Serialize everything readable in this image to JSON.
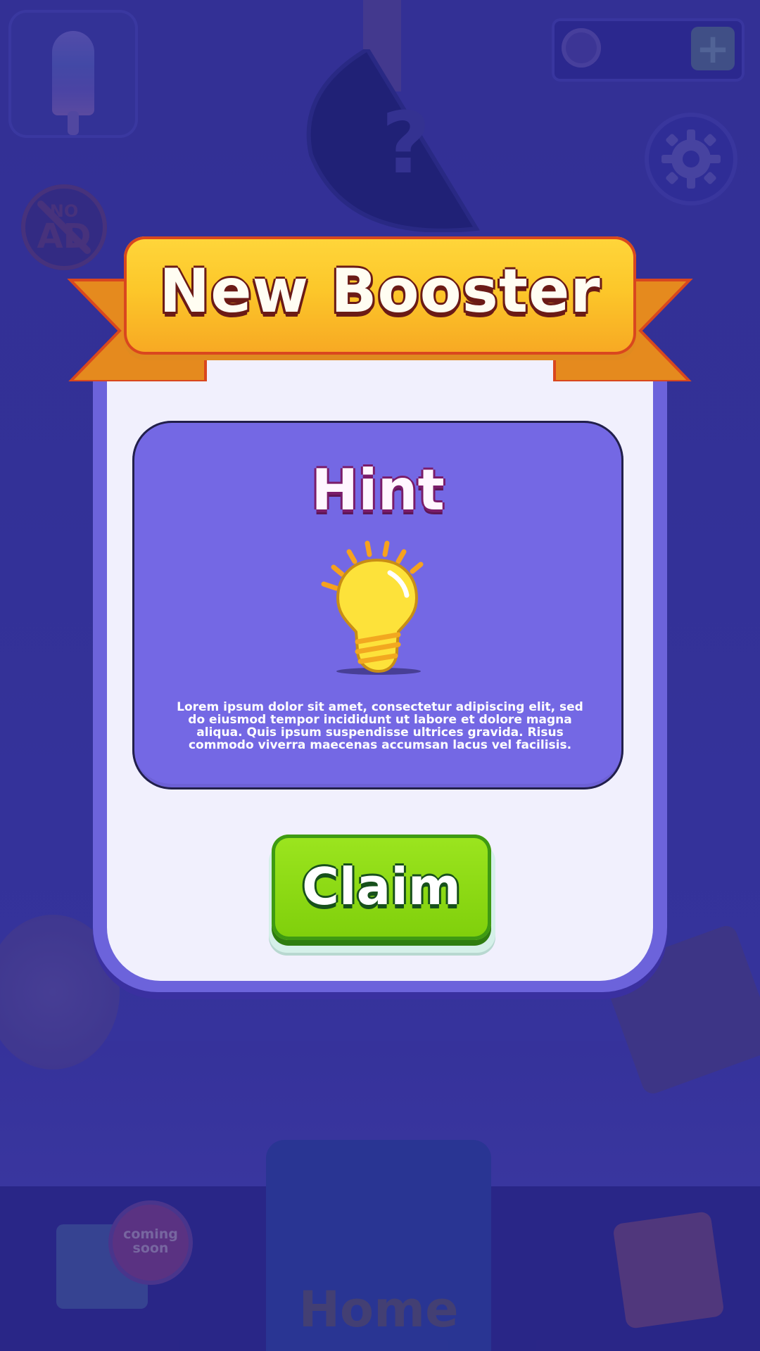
{
  "dialog": {
    "title": "New Booster",
    "booster_name": "Hint",
    "description": "Lorem ipsum dolor sit amet, consectetur adipiscing elit, sed do eiusmod tempor incididunt ut labore et dolore magna aliqua. Quis ipsum suspendisse ultrices gravida. Risus commodo viverra maecenas accumsan lacus vel facilisis.",
    "claim_label": "Claim",
    "booster_icon": "light-bulb-icon"
  },
  "background": {
    "noad_line1": "NO",
    "noad_line2": "AD",
    "mystery_symbol": "?",
    "plus_symbol": "+",
    "coming_soon": "coming soon",
    "home_label": "Home"
  },
  "colors": {
    "dialog_border": "#6c63db",
    "dialog_fill": "#f1f0fd",
    "panel_fill": "#7468e4",
    "banner_gold": "#fcc72a",
    "claim_green": "#8fdc12"
  }
}
